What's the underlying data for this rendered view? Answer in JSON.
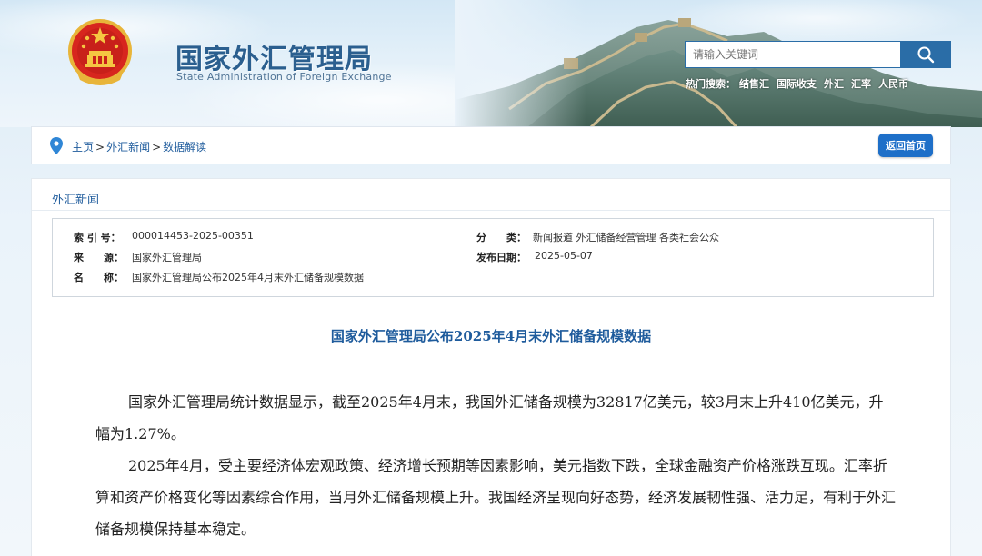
{
  "header": {
    "site_title": "国家外汇管理局",
    "site_subtitle": "State Administration of Foreign Exchange",
    "search_placeholder": "请输入关键词",
    "hot_search_label": "热门搜索：",
    "hot_search_items": [
      "结售汇",
      "国际收支",
      "外汇",
      "汇率",
      "人民币"
    ]
  },
  "breadcrumb": {
    "items": [
      "主页",
      "外汇新闻",
      "数据解读"
    ],
    "separator": ">",
    "home_button": "返回首页"
  },
  "section": {
    "title": "外汇新闻"
  },
  "meta": {
    "index_label": "索 引 号：",
    "index_value": "000014453-2025-00351",
    "category_label": "分　　类：",
    "category_value": "新闻报道 外汇储备经营管理 各类社会公众",
    "source_label": "来　　源：",
    "source_value": "国家外汇管理局",
    "date_label": "发布日期：",
    "date_value": "2025-05-07",
    "name_label": "名　　称：",
    "name_value": "国家外汇管理局公布2025年4月末外汇储备规模数据"
  },
  "article": {
    "title": "国家外汇管理局公布2025年4月末外汇储备规模数据",
    "paragraphs": [
      "国家外汇管理局统计数据显示，截至2025年4月末，我国外汇储备规模为32817亿美元，较3月末上升410亿美元，升幅为1.27%。",
      "2025年4月，受主要经济体宏观政策、经济增长预期等因素影响，美元指数下跌，全球金融资产价格涨跌互现。汇率折算和资产价格变化等因素综合作用，当月外汇储备规模上升。我国经济呈现向好态势，经济发展韧性强、活力足，有利于外汇储备规模保持基本稳定。"
    ]
  },
  "colors": {
    "link_blue": "#1e5b9c",
    "button_blue": "#1e6fc8",
    "search_blue": "#2a6da7"
  },
  "icons": {
    "emblem": "national-emblem-icon",
    "search": "search-icon",
    "pin": "location-pin-icon"
  }
}
